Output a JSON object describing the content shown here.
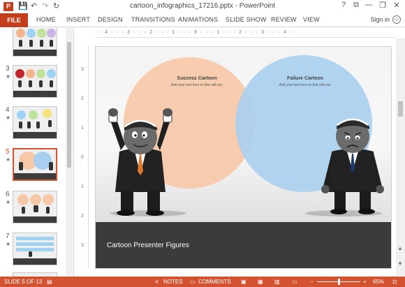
{
  "window": {
    "title": "cartoon_infographics_17216.pptx - PowerPoint",
    "help_glyph": "?",
    "min_glyph": "—",
    "restore_glyph": "❐",
    "close_glyph": "✕",
    "ribbon_display_glyph": "⧉"
  },
  "qat": {
    "save_glyph": "💾",
    "undo_glyph": "↶",
    "redo_glyph": "↷",
    "repeat_glyph": "↻"
  },
  "ribbon": {
    "tabs": [
      "FILE",
      "HOME",
      "INSERT",
      "DESIGN",
      "TRANSITIONS",
      "ANIMATIONS",
      "SLIDE SHOW",
      "REVIEW",
      "VIEW"
    ],
    "signin": "Sign in"
  },
  "thumbnails": [
    {
      "num": "3",
      "star": "★"
    },
    {
      "num": "4",
      "star": "★"
    },
    {
      "num": "5",
      "star": "★"
    },
    {
      "num": "6",
      "star": "★"
    },
    {
      "num": "7",
      "star": "★"
    }
  ],
  "ruler": {
    "horizontal": "· 4 · · · 3 · · · 2 · · · 1 · · · 0 · · · 1 · · · 2 · · · 3 · · · 4 ·",
    "vertical": [
      "3",
      "2",
      "1",
      "0",
      "1",
      "2",
      "3"
    ]
  },
  "slide": {
    "success_title": "Success Cartoon",
    "success_sub": "Add your text here to this call-out.",
    "failure_title": "Failure Cartoon",
    "failure_sub": "Add your text here to this call-out.",
    "footer_title": "Cartoon Presenter Figures"
  },
  "status": {
    "slide_info": "SLIDE 5 OF 13",
    "notes": "NOTES",
    "comments": "COMMENTS",
    "zoom_minus": "−",
    "zoom_plus": "+",
    "zoom": "65%"
  },
  "colors": {
    "accent": "#d35230",
    "success_circle": "#f7c8a7",
    "failure_circle": "#a9cff0",
    "footer_bar": "#3b3b3b"
  }
}
